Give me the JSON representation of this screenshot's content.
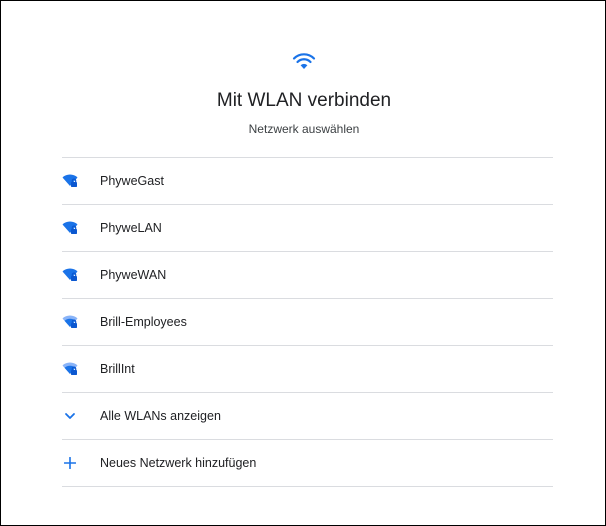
{
  "header": {
    "icon": "wifi-icon",
    "title": "Mit WLAN verbinden",
    "subtitle": "Netzwerk auswählen"
  },
  "networks": [
    {
      "name": "PhyweGast",
      "icon": "wifi-locked-icon"
    },
    {
      "name": "PhyweLAN",
      "icon": "wifi-locked-icon"
    },
    {
      "name": "PhyweWAN",
      "icon": "wifi-locked-icon"
    },
    {
      "name": "Brill-Employees",
      "icon": "wifi-locked-icon"
    },
    {
      "name": "BrillInt",
      "icon": "wifi-locked-icon"
    }
  ],
  "actions": {
    "show_all": {
      "label": "Alle WLANs anzeigen",
      "icon": "chevron-down-icon"
    },
    "add_network": {
      "label": "Neues Netzwerk hinzufügen",
      "icon": "plus-icon"
    }
  },
  "colors": {
    "accent": "#1a73e8",
    "divider": "#dadce0",
    "text": "#202124"
  }
}
